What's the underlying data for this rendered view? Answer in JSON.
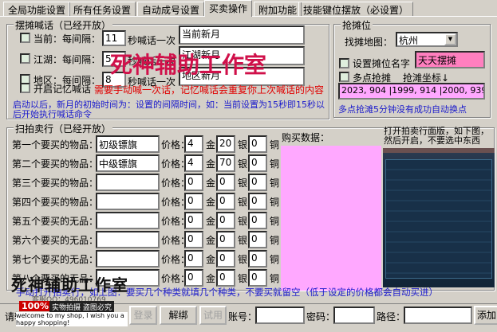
{
  "tabs": [
    "全局功能设置",
    "所有任务设置",
    "自动成号设置",
    "买卖操作",
    "附加功能",
    "技能键位摆放（必设置）"
  ],
  "shout": {
    "title": "摆摊喊话（已经开放）",
    "rows": [
      {
        "label": "当前：",
        "interval_label": "每间隔：",
        "interval": "11",
        "suffix": "秒喊话一次",
        "message": "当前新月"
      },
      {
        "label": "江湖：",
        "interval_label": "每间隔：",
        "interval": "5",
        "suffix": "秒喊话一次",
        "message": "江湖新月"
      },
      {
        "label": "地区：",
        "interval_label": "每间隔：",
        "interval": "8",
        "suffix": "秒喊话一次",
        "message": "地区新月"
      }
    ],
    "memory_label": "开启记忆喊话",
    "memory_note": "需要手动喊一次话，记忆喊话会重复你上次喊话的内容",
    "info": "启动以后，新月的初始时间为：设置的间隔时间，如：当前设置为15秒即15秒以后开始执行喊话命令"
  },
  "stall": {
    "title": "抢摊位",
    "map_label": "找摊地图：",
    "map_value": "杭州",
    "name_label": "设置摊位名字",
    "name_value": "天天摆摊",
    "multi_label": "多点抢摊",
    "coord_label": "抢滩坐标↓",
    "coords": "2023, 904 |1999, 914 |2000, 939",
    "note": "多点抢滩5分钟没有成功自动换点"
  },
  "auction": {
    "title": "扫拍卖行（已经开放）",
    "price_label": "价格：",
    "gold": "金",
    "silver": "银",
    "copper": "铜",
    "buy_data_label": "购买数据：",
    "hint": "打开拍卖行面版，如下图，然后开启，不要选中东西",
    "items": [
      {
        "label": "第一个要买的物品：",
        "name": "初级镖旗",
        "g": "4",
        "s": "20",
        "c": "0"
      },
      {
        "label": "第二个要买的物品：",
        "name": "中级镖旗",
        "g": "4",
        "s": "70",
        "c": "0"
      },
      {
        "label": "第三个要买的物品：",
        "name": "",
        "g": "0",
        "s": "0",
        "c": "0"
      },
      {
        "label": "第四个要买的物品：",
        "name": "",
        "g": "0",
        "s": "0",
        "c": "0"
      },
      {
        "label": "第五个要买的无品：",
        "name": "",
        "g": "0",
        "s": "0",
        "c": "0"
      },
      {
        "label": "第六个要买的无品：",
        "name": "",
        "g": "0",
        "s": "0",
        "c": "0"
      },
      {
        "label": "第七个要买的无品：",
        "name": "",
        "g": "0",
        "s": "0",
        "c": "0"
      },
      {
        "label": "第八个要买的无品：",
        "name": "",
        "g": "0",
        "s": "0",
        "c": "0"
      }
    ],
    "footer": "手动打开拍卖行，如上图：要买几个种类就填几个种类，不要买就留空（低于设定的价格都会自动买进）"
  },
  "watermark": "死神辅助工作室",
  "qq": "客服QQ：496010769",
  "badge": "100%",
  "badge2": "实物拍摄 盗图必究",
  "shop": "welcome to my shop, I wish you a happy shopping!",
  "bottom": {
    "prompt": "请输入",
    "login": "登录",
    "unbind": "解绑",
    "trial": "试用",
    "account": "账号：",
    "password": "密码：",
    "path": "路径：",
    "add": "添加"
  }
}
